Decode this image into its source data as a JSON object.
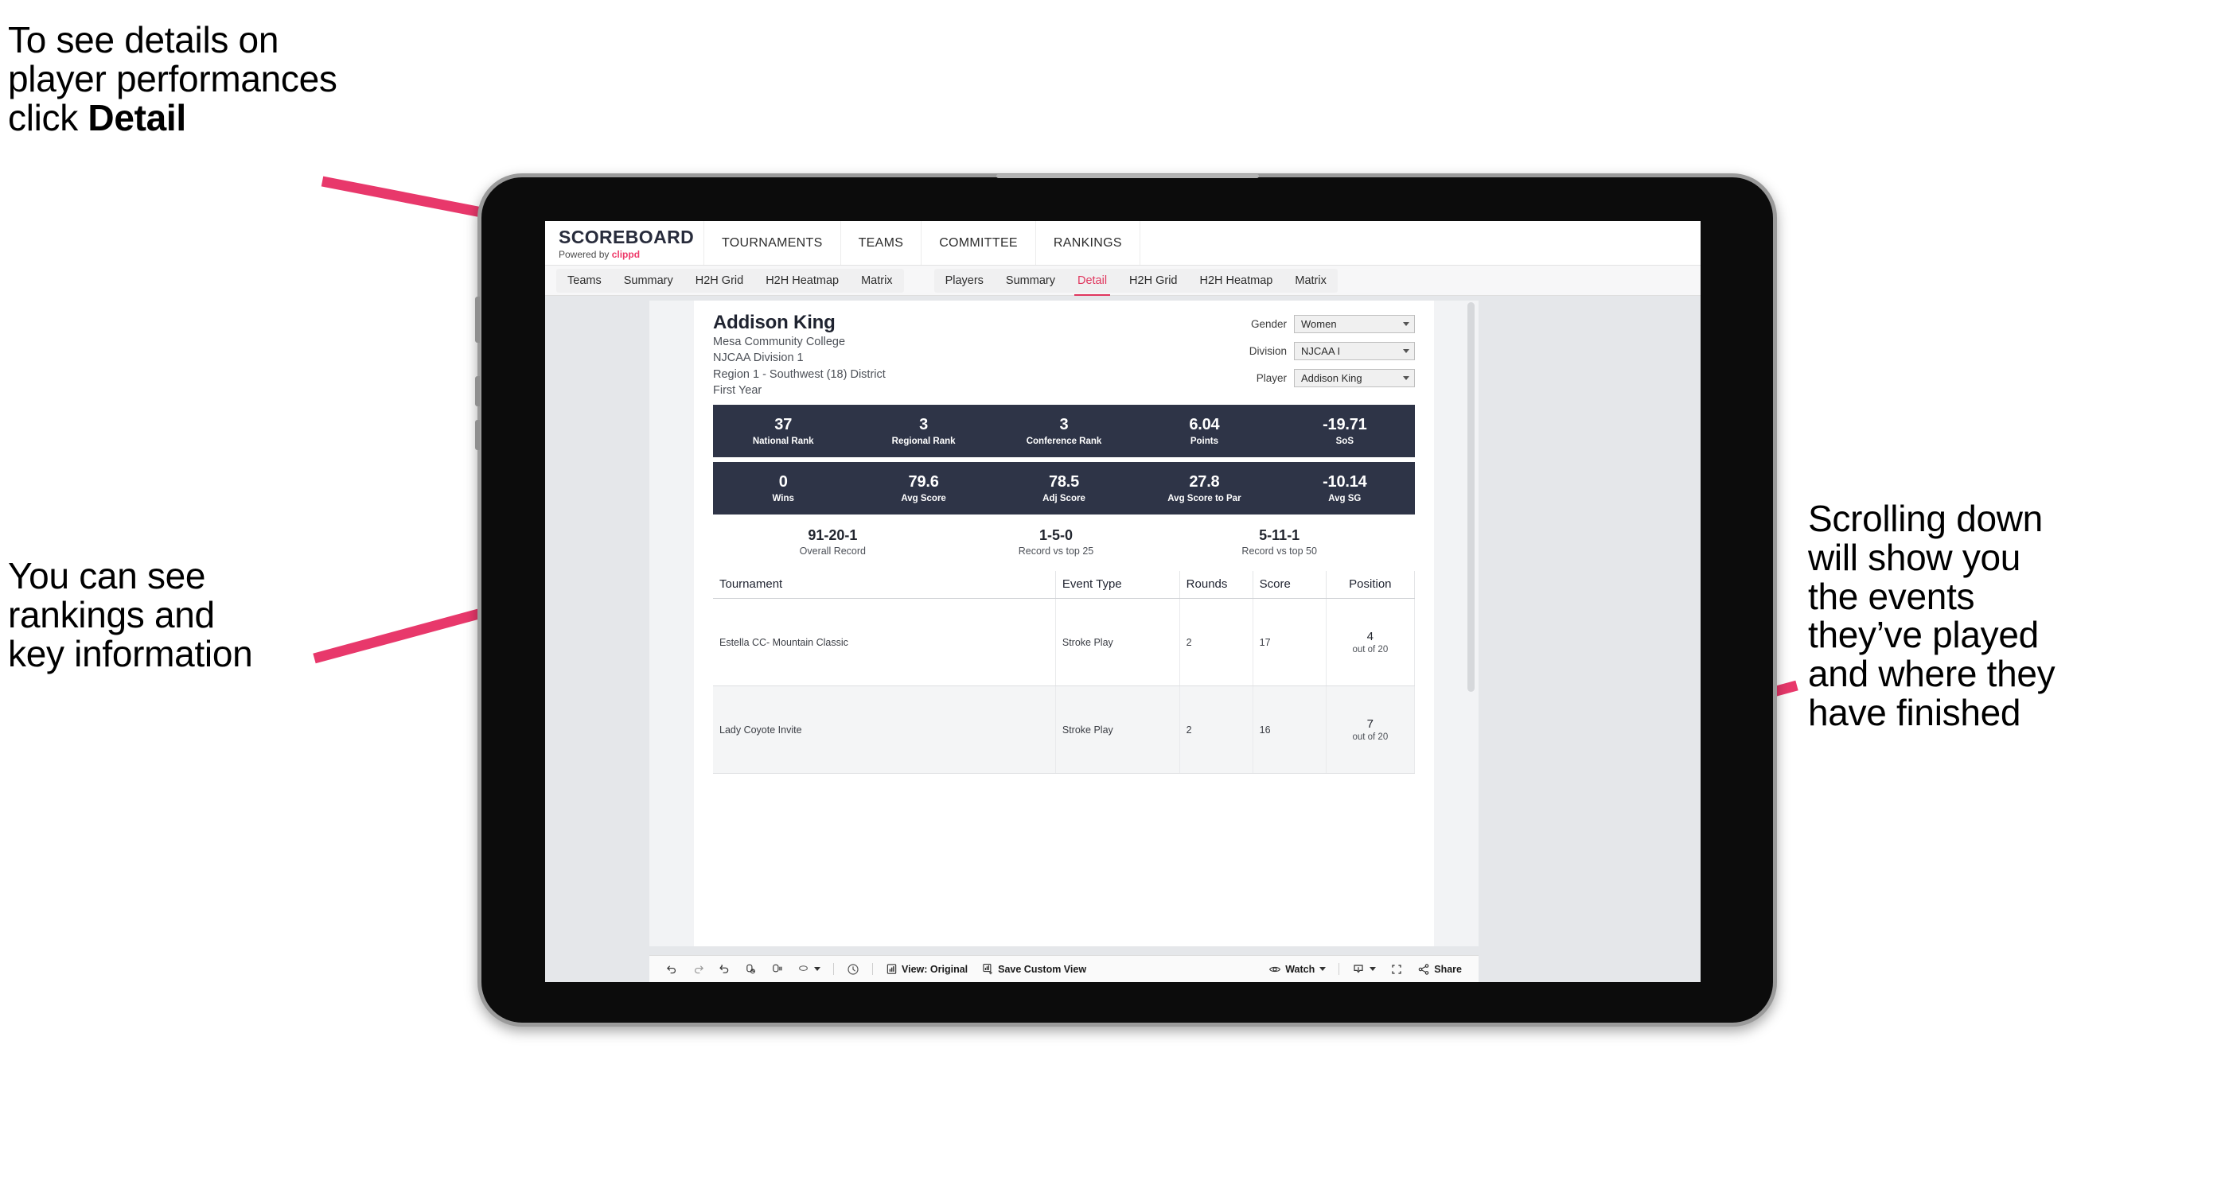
{
  "annotations": {
    "detail": {
      "pre": "To see details on\nplayer performances\nclick ",
      "bold": "Detail"
    },
    "rankings": "You can see\nrankings and\nkey information",
    "scrolling": "Scrolling down\nwill show you\nthe events\nthey’ve played\nand where they\nhave finished"
  },
  "colors": {
    "accent_pink": "#ee3a6a",
    "arrow_pink": "#e8386b",
    "band_navy": "#2e3447",
    "active_tab": "#e0365e"
  },
  "app": {
    "brand": {
      "name": "SCOREBOARD",
      "powered_prefix": "Powered by ",
      "powered_brand": "clippd"
    },
    "top_nav": [
      "TOURNAMENTS",
      "TEAMS",
      "COMMITTEE",
      "RANKINGS"
    ],
    "tab_group_teams": [
      "Teams",
      "Summary",
      "H2H Grid",
      "H2H Heatmap",
      "Matrix"
    ],
    "tab_group_players": [
      "Players",
      "Summary",
      "Detail",
      "H2H Grid",
      "H2H Heatmap",
      "Matrix"
    ],
    "active_tab": "Detail"
  },
  "player": {
    "name": "Addison King",
    "school": "Mesa Community College",
    "division": "NJCAA Division 1",
    "region": "Region 1 - Southwest (18) District",
    "year": "First Year"
  },
  "filters": [
    {
      "label": "Gender",
      "value": "Women"
    },
    {
      "label": "Division",
      "value": "NJCAA I"
    },
    {
      "label": "Player",
      "value": "Addison King"
    }
  ],
  "stats_band_1": [
    {
      "value": "37",
      "label": "National Rank"
    },
    {
      "value": "3",
      "label": "Regional Rank"
    },
    {
      "value": "3",
      "label": "Conference Rank"
    },
    {
      "value": "6.04",
      "label": "Points"
    },
    {
      "value": "-19.71",
      "label": "SoS"
    }
  ],
  "stats_band_2": [
    {
      "value": "0",
      "label": "Wins"
    },
    {
      "value": "79.6",
      "label": "Avg Score"
    },
    {
      "value": "78.5",
      "label": "Adj Score"
    },
    {
      "value": "27.8",
      "label": "Avg Score to Par"
    },
    {
      "value": "-10.14",
      "label": "Avg SG"
    }
  ],
  "records": [
    {
      "value": "91-20-1",
      "label": "Overall Record"
    },
    {
      "value": "1-5-0",
      "label": "Record vs top 25"
    },
    {
      "value": "5-11-1",
      "label": "Record vs top 50"
    }
  ],
  "tournament_table": {
    "headers": [
      "Tournament",
      "Event Type",
      "Rounds",
      "Score",
      "Position"
    ],
    "rows": [
      {
        "tournament": "Estella CC- Mountain Classic",
        "event_type": "Stroke Play",
        "rounds": "2",
        "score": "17",
        "position": "4",
        "position_out_of": "out of 20"
      },
      {
        "tournament": "Lady Coyote Invite",
        "event_type": "Stroke Play",
        "rounds": "2",
        "score": "16",
        "position": "7",
        "position_out_of": "out of 20"
      }
    ]
  },
  "toolbar": {
    "view_label": "View: Original",
    "save_label": "Save Custom View",
    "watch_label": "Watch",
    "share_label": "Share"
  }
}
